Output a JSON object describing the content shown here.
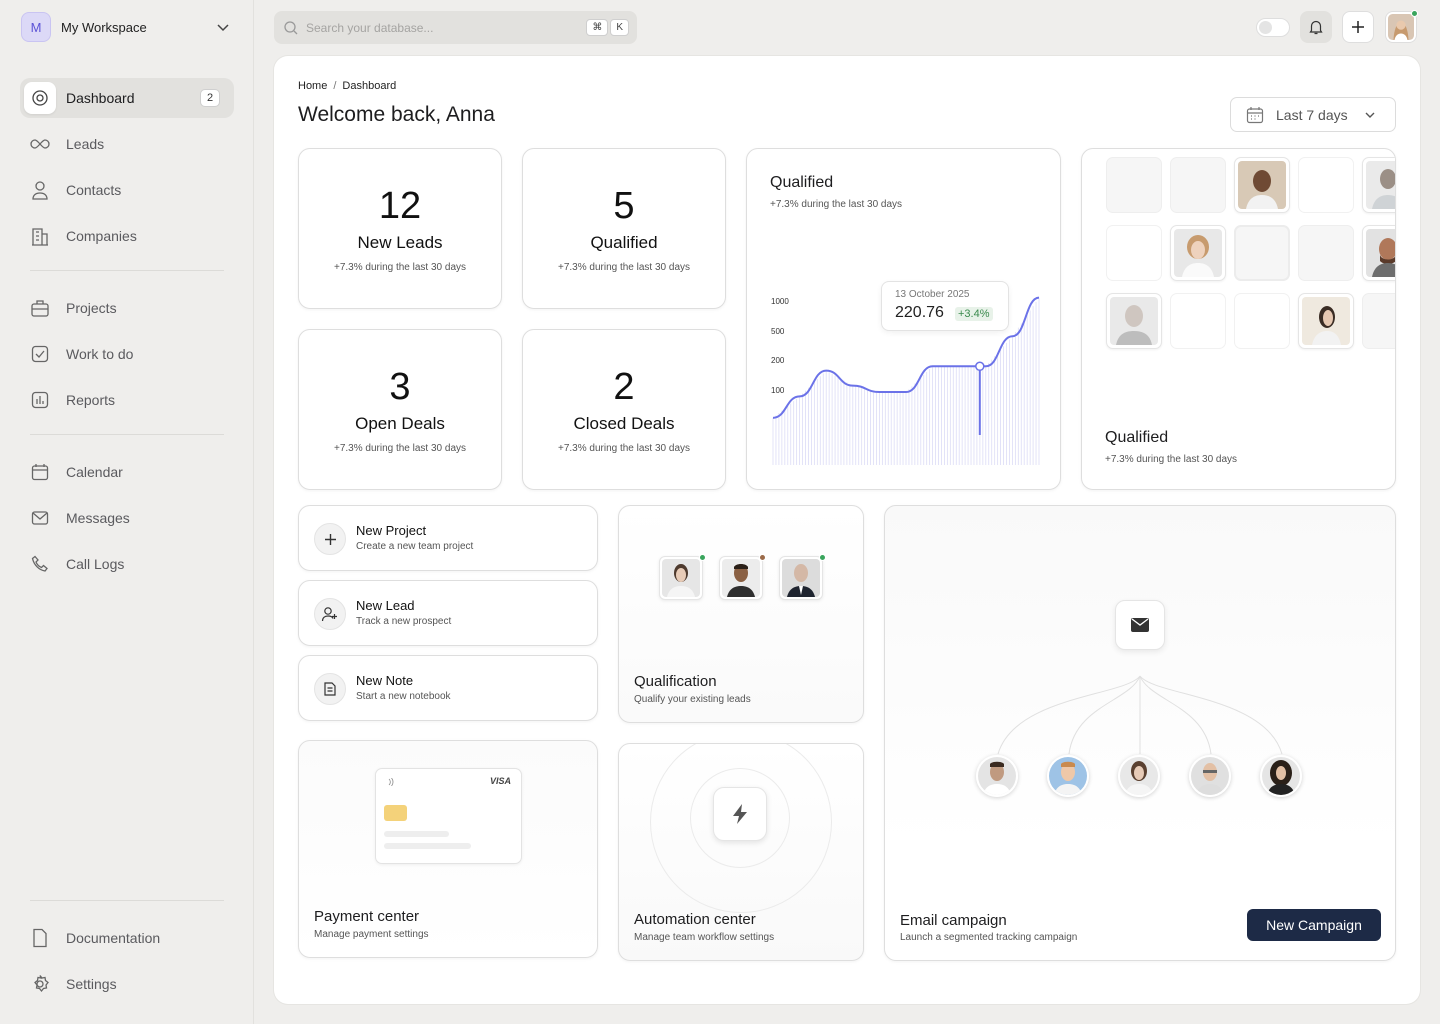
{
  "workspace": {
    "initial": "M",
    "name": "My Workspace"
  },
  "nav": {
    "items": [
      {
        "label": "Dashboard",
        "badge": "2"
      },
      {
        "label": "Leads"
      },
      {
        "label": "Contacts"
      },
      {
        "label": "Companies"
      },
      {
        "label": "Projects"
      },
      {
        "label": "Work to do"
      },
      {
        "label": "Reports"
      },
      {
        "label": "Calendar"
      },
      {
        "label": "Messages"
      },
      {
        "label": "Call Logs"
      }
    ],
    "footer": [
      {
        "label": "Documentation"
      },
      {
        "label": "Settings"
      }
    ]
  },
  "search": {
    "placeholder": "Search your database...",
    "shortcut_mod": "⌘",
    "shortcut_key": "K"
  },
  "header": {
    "breadcrumb": {
      "home": "Home",
      "sep": "/",
      "current": "Dashboard"
    },
    "title": "Welcome back, Anna",
    "date_range": "Last 7 days"
  },
  "stats": [
    {
      "value": "12",
      "label": "New Leads",
      "sub": "+7.3% during the last 30 days"
    },
    {
      "value": "5",
      "label": "Qualified",
      "sub": "+7.3% during the last 30 days"
    },
    {
      "value": "3",
      "label": "Open Deals",
      "sub": "+7.3% during the last 30 days"
    },
    {
      "value": "2",
      "label": "Closed Deals",
      "sub": "+7.3% during the last 30 days"
    }
  ],
  "chart_card": {
    "title": "Qualified",
    "sub": "+7.3% during the last 30 days",
    "tooltip": {
      "date": "13 October 2025",
      "value": "220.76",
      "change": "+3.4%"
    }
  },
  "chart_data": {
    "type": "area",
    "title": "Qualified",
    "y_ticks": [
      "1000",
      "500",
      "200",
      "100"
    ],
    "series": [
      {
        "values": [
          40,
          90,
          150,
          115,
          100,
          100,
          160,
          160,
          160,
          230,
          320
        ]
      }
    ],
    "highlight_index": 8,
    "grid": false
  },
  "people_card": {
    "title": "Qualified",
    "sub": "+7.3% during the last 30 days"
  },
  "actions": [
    {
      "title": "New Project",
      "sub": "Create a new team project",
      "icon": "plus-icon"
    },
    {
      "title": "New Lead",
      "sub": "Track a new prospect",
      "icon": "user-plus-icon"
    },
    {
      "title": "New Note",
      "sub": "Start a new notebook",
      "icon": "note-icon"
    }
  ],
  "qualification": {
    "title": "Qualification",
    "sub": "Qualify your existing leads"
  },
  "payment": {
    "title": "Payment center",
    "sub": "Manage payment settings",
    "card_brand": "VISA"
  },
  "automation": {
    "title": "Automation center",
    "sub": "Manage team workflow settings"
  },
  "email": {
    "title": "Email campaign",
    "sub": "Launch a segmented tracking campaign",
    "button": "New Campaign"
  },
  "colors": {
    "accent": "#6b72e8",
    "primary_button": "#1d2a46",
    "online": "#3aa55d",
    "away": "#9b6b4a"
  }
}
